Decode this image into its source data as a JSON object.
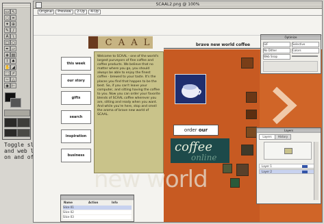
{
  "window": {
    "title": "SCAAL2.png @ 100%"
  },
  "tabs": [
    "Original",
    "Preview",
    "2-Up",
    "4-Up"
  ],
  "site": {
    "logo_letters": [
      "S",
      "C",
      "A",
      "A",
      "L"
    ],
    "tagline": "brave new world coffee",
    "nav": [
      "this week",
      "our story",
      "gifts",
      "search",
      "inspiration",
      "business"
    ],
    "welcome_text": "Welcome to SCAAL - one of the world's largest purveyors of fine coffee and coffee products. We believe that no matter where you go, you should always be able to enjoy the finest coffee - brewed to your taste. It's the places you find that happen to be the best. So, if you can't leave your computer, and sitting having the coffee to you. Now you can order your favorite blends of SCAAL coffee wherever you are, sitting and ready when you want. And while you're here, stop and smell the aroma of brave new world of SCAAL.",
    "order_prefix": "order ",
    "order_word": "our",
    "coffee_word": "coffee",
    "online_word": "online",
    "brand_watermark": "new world"
  },
  "caption": [
    "Toggle slices",
    "and web layer",
    "on and off"
  ],
  "palettes": {
    "optimize": {
      "title": "Optimize",
      "rows": [
        "GIF",
        "Selective",
        "No Dither",
        "Colors",
        "Web Snap"
      ]
    },
    "layers": {
      "title": "Layers",
      "tabs": [
        "Layers",
        "History"
      ],
      "items": [
        "Layer 1",
        "Layer 2"
      ]
    },
    "slices": {
      "headers": [
        "Name",
        "Action",
        "Info"
      ],
      "rows": [
        "Slice 01",
        "Slice 02",
        "Slice 03"
      ]
    }
  }
}
